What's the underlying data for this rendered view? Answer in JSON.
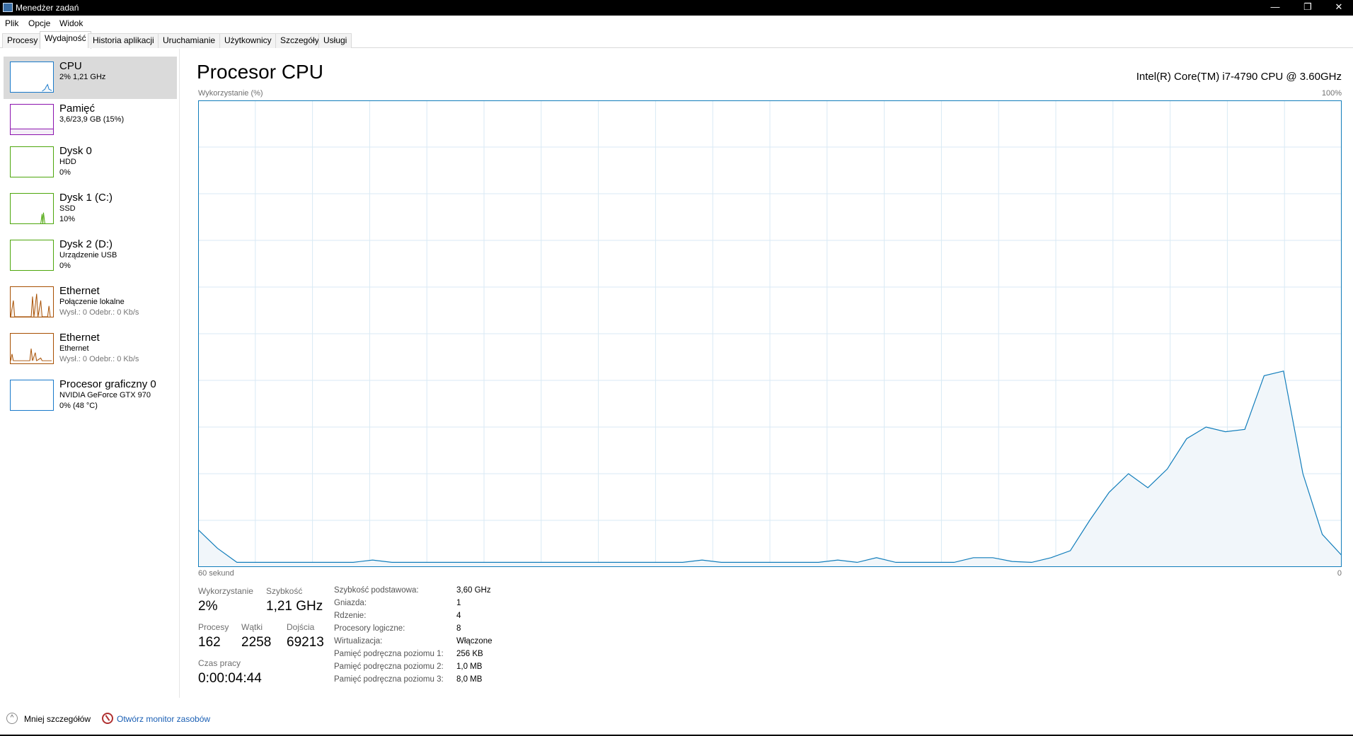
{
  "window": {
    "title": "Menedżer zadań",
    "controls": {
      "minimize": "—",
      "restore": "❐",
      "close": "✕"
    }
  },
  "menu": [
    "Plik",
    "Opcje",
    "Widok"
  ],
  "tabs": [
    "Procesy",
    "Wydajność",
    "Historia aplikacji",
    "Uruchamianie",
    "Użytkownicy",
    "Szczegóły",
    "Usługi"
  ],
  "active_tab": "Wydajność",
  "sidebar": {
    "items": [
      {
        "name": "CPU",
        "sub1": "2% 1,21 GHz",
        "sub2": "",
        "color": "#1979ca",
        "selected": true
      },
      {
        "name": "Pamięć",
        "sub1": "3,6/23,9 GB (15%)",
        "sub2": "",
        "color": "#8b12ae"
      },
      {
        "name": "Dysk 0",
        "sub1": "HDD",
        "sub2": "0%",
        "color": "#4da60c"
      },
      {
        "name": "Dysk 1 (C:)",
        "sub1": "SSD",
        "sub2": "10%",
        "color": "#4da60c"
      },
      {
        "name": "Dysk 2 (D:)",
        "sub1": "Urządzenie USB",
        "sub2": "0%",
        "color": "#4da60c"
      },
      {
        "name": "Ethernet",
        "sub1": "Połączenie lokalne",
        "sub2": "Wysł.: 0 Odebr.: 0 Kb/s",
        "color": "#a74f01"
      },
      {
        "name": "Ethernet",
        "sub1": "Ethernet",
        "sub2": "Wysł.: 0 Odebr.: 0 Kb/s",
        "color": "#a74f01"
      },
      {
        "name": "Procesor graficzny 0",
        "sub1": "NVIDIA GeForce GTX 970",
        "sub2": "0% (48 °C)",
        "color": "#1979ca"
      }
    ]
  },
  "main": {
    "title": "Procesor CPU",
    "cpu_model": "Intel(R) Core(TM) i7-4790 CPU @ 3.60GHz",
    "y_label": "Wykorzystanie (%)",
    "y_max": "100%",
    "x_label": "60 sekund",
    "x_min": "0"
  },
  "chart_data": {
    "type": "area",
    "x_range": [
      60,
      0
    ],
    "y_range": [
      0,
      100
    ],
    "grid": true,
    "color": "#117dbb",
    "fill": "#f1f6fa",
    "values": [
      8,
      4,
      1,
      1,
      1,
      1,
      1,
      1,
      1,
      1.5,
      1,
      1,
      1,
      1,
      1,
      1,
      1,
      1,
      1,
      1,
      1,
      1,
      1,
      1,
      1,
      1,
      1.5,
      1,
      1,
      1,
      1,
      1,
      1,
      1.5,
      1,
      2,
      1,
      1,
      1,
      1,
      2,
      2,
      1.2,
      1,
      2,
      3.5,
      10,
      16,
      20,
      17,
      21,
      27.5,
      30,
      29,
      29.5,
      41,
      42,
      20,
      7,
      2.5
    ]
  },
  "stats": {
    "usage_label": "Wykorzystanie",
    "usage_value": "2%",
    "speed_label": "Szybkość",
    "speed_value": "1,21 GHz",
    "processes_label": "Procesy",
    "processes_value": "162",
    "threads_label": "Wątki",
    "threads_value": "2258",
    "handles_label": "Dojścia",
    "handles_value": "69213",
    "uptime_label": "Czas pracy",
    "uptime_value": "0:00:04:44"
  },
  "details": [
    {
      "key": "Szybkość podstawowa:",
      "value": "3,60 GHz"
    },
    {
      "key": "Gniazda:",
      "value": "1"
    },
    {
      "key": "Rdzenie:",
      "value": "4"
    },
    {
      "key": "Procesory logiczne:",
      "value": "8"
    },
    {
      "key": "Wirtualizacja:",
      "value": "Włączone"
    },
    {
      "key": "Pamięć podręczna poziomu 1:",
      "value": "256 KB"
    },
    {
      "key": "Pamięć podręczna poziomu 2:",
      "value": "1,0 MB"
    },
    {
      "key": "Pamięć podręczna poziomu 3:",
      "value": "8,0 MB"
    }
  ],
  "footer": {
    "less_details": "Mniej szczegółów",
    "open_monitor": "Otwórz monitor zasobów"
  }
}
